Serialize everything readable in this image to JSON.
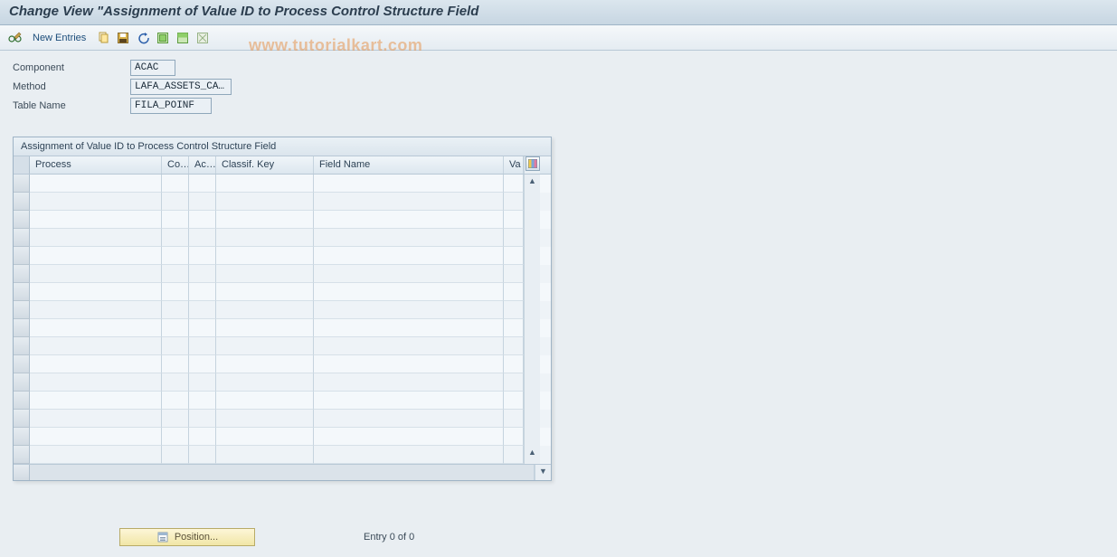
{
  "title": "Change View \"Assignment of Value ID to Process Control Structure Field",
  "toolbar": {
    "new_entries_label": "New Entries"
  },
  "watermark": "www.tutorialkart.com",
  "form": {
    "component_label": "Component",
    "component_value": "ACAC",
    "method_label": "Method",
    "method_value": "LAFA_ASSETS_CA…",
    "table_label": "Table Name",
    "table_value": "FILA_POINF"
  },
  "grid": {
    "title": "Assignment of Value ID to Process Control Structure Field",
    "columns": {
      "process": "Process",
      "co": "Co…",
      "ac": "Ac…",
      "classif": "Classif. Key",
      "field": "Field Name",
      "va": "Va"
    },
    "row_count": 16
  },
  "footer": {
    "position_label": "Position...",
    "entry_text": "Entry 0 of 0"
  }
}
